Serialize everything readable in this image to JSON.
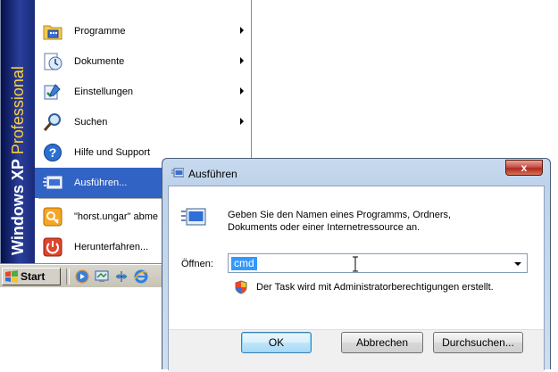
{
  "start_menu": {
    "brand": {
      "part1": "Windows XP",
      "part2": "Professional"
    },
    "items": [
      {
        "label": "Programme",
        "icon": "programs-folder-icon",
        "submenu": true
      },
      {
        "label": "Dokumente",
        "icon": "documents-icon",
        "submenu": true
      },
      {
        "label": "Einstellungen",
        "icon": "settings-icon",
        "submenu": true
      },
      {
        "label": "Suchen",
        "icon": "search-icon",
        "submenu": true
      },
      {
        "label": "Hilfe und Support",
        "icon": "help-icon",
        "submenu": false
      },
      {
        "label": "Ausführen...",
        "icon": "run-icon",
        "submenu": false,
        "selected": true
      },
      {
        "label": "\"horst.ungar\" abme",
        "icon": "logoff-icon",
        "submenu": false
      },
      {
        "label": "Herunterfahren...",
        "icon": "shutdown-icon",
        "submenu": false
      }
    ]
  },
  "taskbar": {
    "start_label": "Start",
    "quick_launch": [
      "media-player-icon",
      "desktop-icon",
      "network-icon",
      "internet-explorer-icon"
    ]
  },
  "run_dialog": {
    "title": "Ausführen",
    "close_label": "x",
    "description": "Geben Sie den Namen eines Programms, Ordners, oder Dokuments oder einer Internetressource an.",
    "description_line1": "Geben Sie den Namen eines Programms, Ordners,",
    "description_line2": "Dokuments oder einer Internetressource an.",
    "open_label": "Öffnen:",
    "open_value": "cmd",
    "admin_note": "Der Task wird mit Administratorberechtigungen erstellt.",
    "buttons": {
      "ok": "OK",
      "cancel": "Abbrechen",
      "browse": "Durchsuchen..."
    }
  },
  "colors": {
    "selection": "#3163c5",
    "brand_dark": "#050f4a",
    "brand_accent": "#ffcf3a",
    "highlight": "#3399ff"
  }
}
